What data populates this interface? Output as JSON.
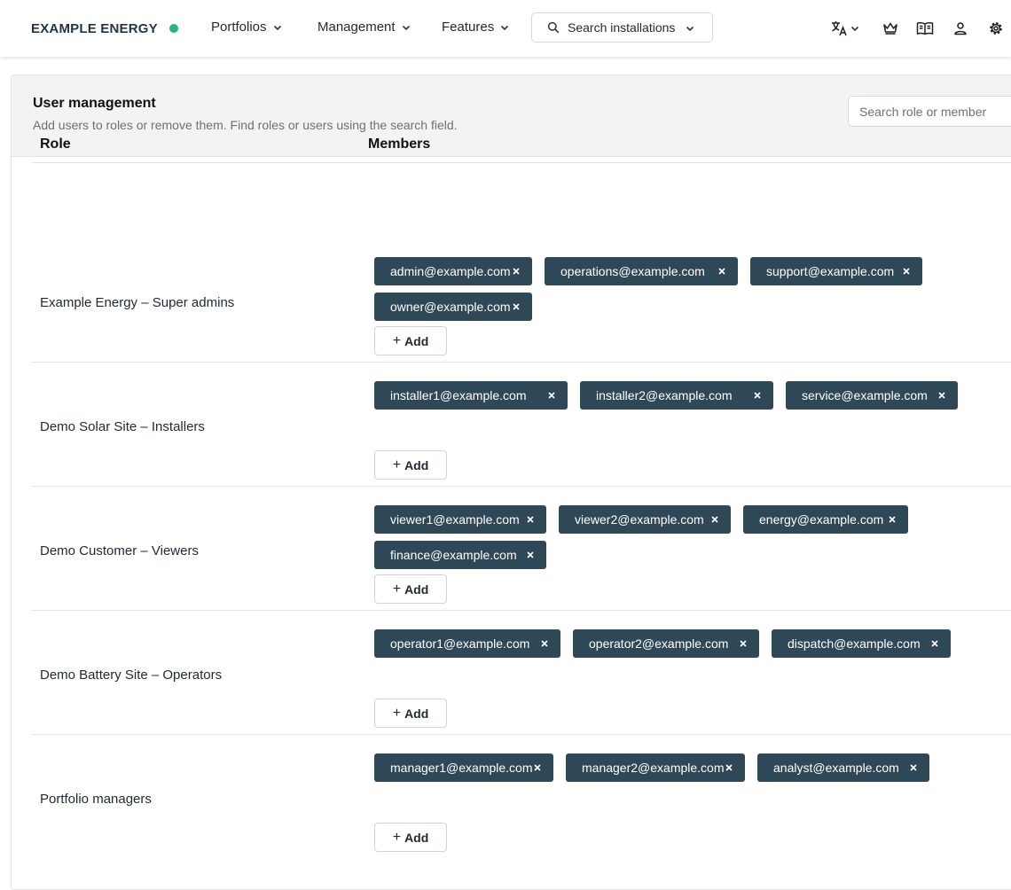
{
  "header": {
    "brand": "EXAMPLE ENERGY",
    "status_color": "#21b685",
    "menus": [
      "Portfolios",
      "Management",
      "Features"
    ],
    "search_label": "Search installations",
    "icons": [
      "translate-icon",
      "crown-icon",
      "book-icon",
      "user-icon",
      "settings-icon"
    ]
  },
  "page": {
    "title": "User management",
    "subtitle": "Add users to roles or remove them. Find roles or users using the search field.",
    "search_placeholder": "Search role or member",
    "col_role": "Role",
    "col_members": "Members",
    "add_label": "Add"
  },
  "roles": [
    {
      "name": "Example Energy – Super admins",
      "members": [
        "admin@example.com",
        "operations@example.com",
        "support@example.com",
        "owner@example.com"
      ]
    },
    {
      "name": "Demo Solar Site – Installers",
      "members": [
        "installer1@example.com",
        "installer2@example.com",
        "service@example.com"
      ]
    },
    {
      "name": "Demo Customer – Viewers",
      "members": [
        "viewer1@example.com",
        "viewer2@example.com",
        "energy@example.com",
        "finance@example.com"
      ]
    },
    {
      "name": "Demo Battery Site – Operators",
      "members": [
        "operator1@example.com",
        "operator2@example.com",
        "dispatch@example.com"
      ]
    },
    {
      "name": "Portfolio managers",
      "members": [
        "manager1@example.com",
        "manager2@example.com",
        "analyst@example.com"
      ]
    }
  ]
}
